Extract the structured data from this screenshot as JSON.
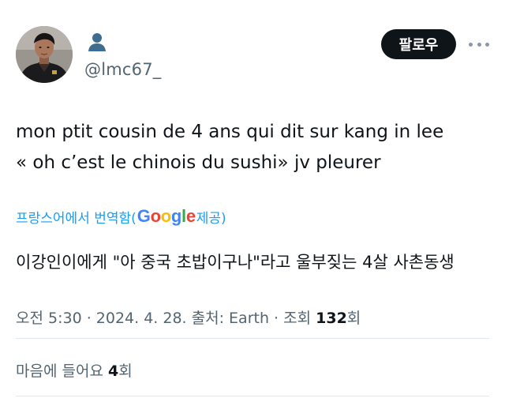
{
  "author": {
    "handle": "@lmc67_",
    "avatar_icon": "profile-photo",
    "name_icon": "person-icon"
  },
  "actions": {
    "follow_label": "팔로우",
    "more_icon": "more-horizontal-icon"
  },
  "tweet": {
    "lines": [
      "mon ptit cousin de 4 ans qui dit sur kang in lee",
      "« oh c’est le chinois du sushi» jv pleurer"
    ]
  },
  "translation": {
    "prefix": "프랑스어에서 번역함(",
    "provider": "Google",
    "suffix": " 제공)",
    "text": "이강인이에게 \"아 중국 초밥이구나\"라고 울부짖는 4살 사촌동생"
  },
  "meta": {
    "prefix": "오전 5:30 · 2024. 4. 28. 출처: Earth · 조회 ",
    "views": "132",
    "views_suffix": "회"
  },
  "likes": {
    "prefix": "마음에 들어요 ",
    "count": "4",
    "suffix": "회"
  },
  "colors": {
    "link": "#1d9bf0",
    "muted": "#536471",
    "text": "#0f1419",
    "google": [
      "#4285F4",
      "#EA4335",
      "#FBBC05",
      "#4285F4",
      "#34A853",
      "#EA4335"
    ]
  }
}
